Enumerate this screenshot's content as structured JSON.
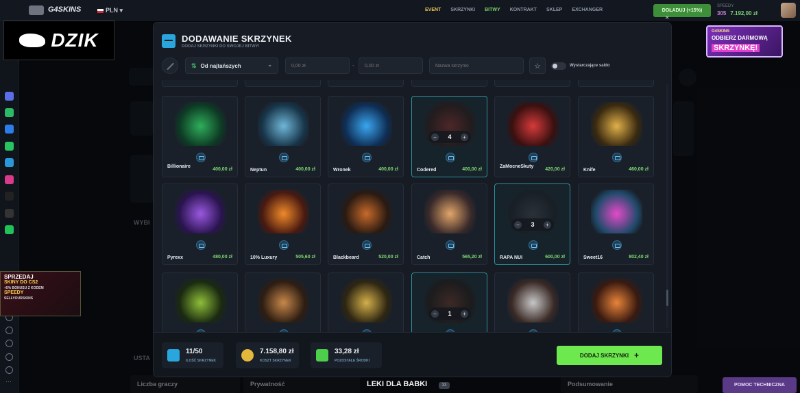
{
  "site": {
    "logo": "G4SKINS",
    "currency": "PLN",
    "nav": [
      {
        "label": "EVENT",
        "style": "active"
      },
      {
        "label": "SKRZYNKI",
        "style": ""
      },
      {
        "label": "BITWY",
        "style": "green"
      },
      {
        "label": "KONTRAKT",
        "style": ""
      },
      {
        "label": "SKLEP",
        "style": ""
      },
      {
        "label": "EXCHANGER",
        "style": ""
      }
    ],
    "deposit_label": "DOŁADUJ (+15%)",
    "balance_label": "SPEEDY",
    "points": "305",
    "balance": "7.192,00 zł"
  },
  "overlays": {
    "dzik": "DZIK",
    "promo_right": [
      "G4SKINS",
      "ODBIERZ DARMOWĄ",
      "SKRZYNKĘ!"
    ],
    "promo_left": [
      "SPRZEDAJ",
      "SKINY DO CS2",
      "+5% BONUSU Z KODEM",
      "SPEEDY",
      "SELLYOURSKINS"
    ]
  },
  "background": {
    "bg_left_1": "WYBI",
    "bg_left_2": "USTA",
    "bottom": [
      "Liczba graczy",
      "Prywatność",
      "Podsumowanie"
    ],
    "help": "POMOC TECHNICZNA",
    "leki": "LEKI DLA BABKI",
    "leki_count": "33"
  },
  "modal": {
    "title": "DODAWANIE SKRZYNEK",
    "subtitle": "DODAJ SKRZYNKI DO SWOJEJ BITWY!",
    "close": "×",
    "sort": "Od najtańszych",
    "min_placeholder": "0,00 zł",
    "max_placeholder": "0,00 zł",
    "dash": "-",
    "name_placeholder": "Nazwa skrzynki",
    "toggle_label": "Wystarczające saldo",
    "cases": [
      {
        "name": "Billionaire",
        "price": "400,00 zł",
        "qty": null,
        "c1": "#2fae5a",
        "c2": "#0d3b24"
      },
      {
        "name": "Neptun",
        "price": "400,00 zł",
        "qty": null,
        "c1": "#6fb6d8",
        "c2": "#18364a"
      },
      {
        "name": "Wronek",
        "price": "400,00 zł",
        "qty": null,
        "c1": "#3aa6f0",
        "c2": "#0f2e55"
      },
      {
        "name": "Codered",
        "price": "400,00 zł",
        "qty": "4",
        "c1": "#7a2a26",
        "c2": "#2a1614"
      },
      {
        "name": "ZaMocneSkuty",
        "price": "420,00 zł",
        "qty": null,
        "c1": "#d63a3a",
        "c2": "#3a1010"
      },
      {
        "name": "Knife",
        "price": "460,00 zł",
        "qty": null,
        "c1": "#e0b04a",
        "c2": "#3a2a10"
      },
      {
        "name": "Pyrexx",
        "price": "480,00 zł",
        "qty": null,
        "c1": "#9a58e0",
        "c2": "#2a1450"
      },
      {
        "name": "10% Luxury",
        "price": "505,60 zł",
        "qty": null,
        "c1": "#f08a2a",
        "c2": "#4a1a10"
      },
      {
        "name": "Blackbeard",
        "price": "520,00 zł",
        "qty": null,
        "c1": "#c86a2a",
        "c2": "#2a1a12"
      },
      {
        "name": "Catch",
        "price": "565,20 zł",
        "qty": null,
        "c1": "#e2a66a",
        "c2": "#3a2a2a"
      },
      {
        "name": "RAPA NUI",
        "price": "600,00 zł",
        "qty": "3",
        "c1": "#3a3d44",
        "c2": "#1a1c22"
      },
      {
        "name": "Sweet16",
        "price": "802,40 zł",
        "qty": null,
        "c1": "#e44ac8",
        "c2": "#1f4a6a"
      },
      {
        "name": "",
        "price": "",
        "qty": null,
        "c1": "#8fbe3a",
        "c2": "#1a2a10"
      },
      {
        "name": "",
        "price": "",
        "qty": null,
        "c1": "#c8874a",
        "c2": "#2e1e12"
      },
      {
        "name": "",
        "price": "",
        "qty": null,
        "c1": "#d4b04a",
        "c2": "#2e2612"
      },
      {
        "name": "",
        "price": "",
        "qty": "1",
        "c1": "#5a2e22",
        "c2": "#1f1512"
      },
      {
        "name": "",
        "price": "",
        "qty": null,
        "c1": "#c7c7c7",
        "c2": "#3a2a26"
      },
      {
        "name": "",
        "price": "",
        "qty": null,
        "c1": "#e8843a",
        "c2": "#3a1a10"
      }
    ],
    "stats": [
      {
        "value": "11/50",
        "label": "ILOŚĆ SKRZYNEK",
        "icon": "case-icon",
        "color": "#2aa6de"
      },
      {
        "value": "7.158,80 zł",
        "label": "KOSZT SKRZYNEK",
        "icon": "coins-icon",
        "color": "#e4b83a"
      },
      {
        "value": "33,28 zł",
        "label": "POZOSTAŁE ŚRODKI",
        "icon": "wallet-icon",
        "color": "#4ecf4b"
      }
    ],
    "add_button": "DODAJ SKRZYNKI",
    "add_plus": "+"
  }
}
